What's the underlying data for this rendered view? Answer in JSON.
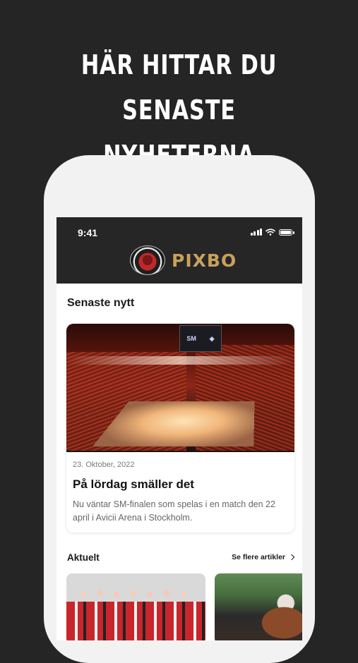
{
  "headline": {
    "line1": "HÄR HITTAR DU SENASTE",
    "line2": "NYHETERNA"
  },
  "status_bar": {
    "time": "9:41",
    "icons": [
      "signal-icon",
      "wifi-icon",
      "battery-icon"
    ]
  },
  "app_header": {
    "brand_name": "PIXBO",
    "brand_color": "#c9a15c",
    "header_bg": "#262626"
  },
  "latest": {
    "section_title": "Senaste nytt",
    "featured": {
      "date": "23. Oktober, 2022",
      "title": "På lördag smäller det",
      "excerpt": "Nu väntar SM-finalen som spelas i en match den 22 april i Avicii Arena i Stockholm."
    }
  },
  "current": {
    "section_title": "Aktuelt",
    "see_more_label": "Se flere artikler"
  }
}
